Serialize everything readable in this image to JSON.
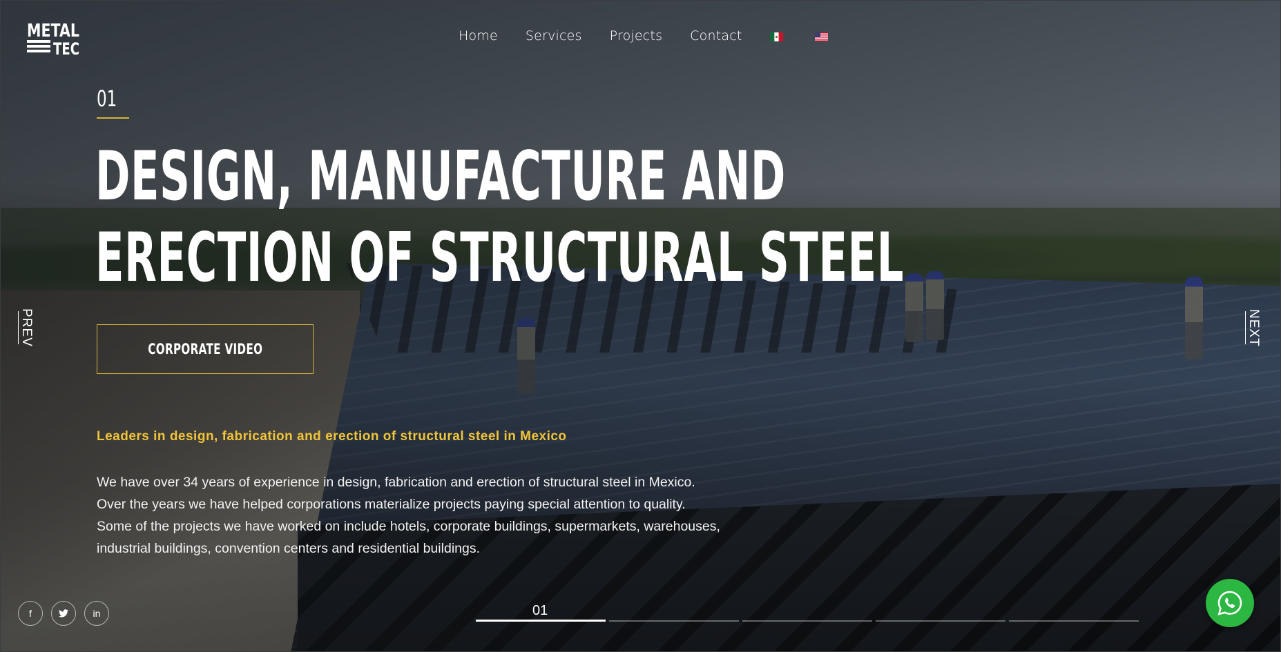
{
  "brand": {
    "logo_text_top": "METAL",
    "logo_text_bottom": "TEC"
  },
  "nav": {
    "items": [
      {
        "label": "Home"
      },
      {
        "label": "Services"
      },
      {
        "label": "Projects"
      },
      {
        "label": "Contact"
      }
    ],
    "flags": [
      {
        "icon": "mexico-flag-icon"
      },
      {
        "icon": "usa-flag-icon"
      }
    ]
  },
  "slide": {
    "number": "01",
    "headline_line1": "DESIGN, MANUFACTURE AND",
    "headline_line2": "ERECTION OF STRUCTURAL STEEL",
    "cta_label": "CORPORATE VIDEO",
    "tagline": "Leaders in design, fabrication and erection of structural steel in Mexico",
    "body_lines": [
      "We have over 34 years of experience in design, fabrication and erection of structural steel in Mexico.",
      "Over the years we have helped corporations materialize projects paying special attention to quality.",
      "Some of the projects we have worked on include hotels, corporate buildings, supermarkets, warehouses,",
      "industrial buildings, convention centers and residential buildings."
    ]
  },
  "arrows": {
    "prev": "PREV",
    "next": "NEXT"
  },
  "socials": [
    {
      "icon": "facebook-icon",
      "glyph": "f"
    },
    {
      "icon": "twitter-icon",
      "glyph": "t"
    },
    {
      "icon": "linkedin-icon",
      "glyph": "in"
    }
  ],
  "progress": {
    "label": "01",
    "total_segments": 5,
    "active_index": 0
  },
  "colors": {
    "accent": "#d4b53a",
    "tagline": "#f0c53a",
    "whatsapp": "#2bb741"
  },
  "whatsapp": {
    "icon": "whatsapp-icon"
  }
}
